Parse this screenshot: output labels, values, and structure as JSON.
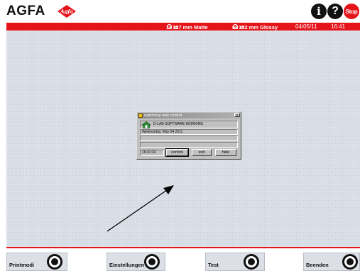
{
  "header": {
    "brand": "AGFA",
    "brand_mark": "Agfa",
    "info_label": "i",
    "help_label": "?",
    "stop_label": "Stop",
    "accent_color": "#e5141b"
  },
  "status": {
    "media1_prefix": "19 m",
    "media1_suffix": "127 mm Matte",
    "media2_prefix": "68 m",
    "media2_suffix": "102 mm Glossy",
    "date": "04/05/11",
    "time": "16:41"
  },
  "dialog": {
    "title": "watchdog task control",
    "close_label": "x",
    "status_text": "D-LAB SOFTWARE WORKING",
    "date_text": "Wednesday, May 04 2011",
    "clock": "16:41:24",
    "buttons": {
      "control": "control",
      "exit": "exit",
      "hide": "hide"
    }
  },
  "bottom": {
    "buttons": [
      {
        "label": "Printmodi"
      },
      {
        "label": "Einstellungen"
      },
      {
        "label": "Test"
      },
      {
        "label": "Beenden"
      }
    ]
  }
}
